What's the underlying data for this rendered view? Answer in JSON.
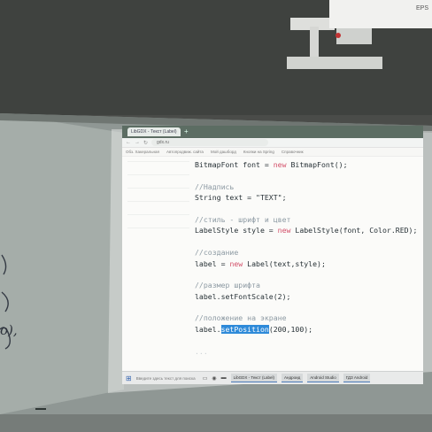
{
  "projector": {
    "brand": "EPS"
  },
  "board_marks": {
    "left_scribble": "o),"
  },
  "browser": {
    "tabs": [
      "LibGDX - Текст (Label)"
    ],
    "new_tab": "+",
    "url": "gdx.ru",
    "bookmarks": [
      "Обз. Хакеральная",
      "Автопродвиж. сайта",
      "Мой дашборд",
      "Кнопки на Spring",
      "Справочник"
    ]
  },
  "code": {
    "line1": "BitmapFont font = new BitmapFont();",
    "line2": "//Надпись",
    "line3": "String text = \"TEXT\";",
    "line4": "//стиль - шрифт и цвет",
    "line5": "LabelStyle style = new LabelStyle(font, Color.RED);",
    "line6": "//создание",
    "line7": "label = new Label(text,style);",
    "line8": "//размер шрифта",
    "line9": "label.setFontScale(2);",
    "line10": "//положение на экране",
    "line11_pre": "label.",
    "line11_hl": "setPosition",
    "line11_post": "(200,100);",
    "line12": "..."
  },
  "taskbar": {
    "search": "Введите здесь текст для поиска",
    "apps": [
      "LibGDX - Текст (Label)",
      "Андроид",
      "Android Studio",
      "ГДЗ Android"
    ]
  }
}
